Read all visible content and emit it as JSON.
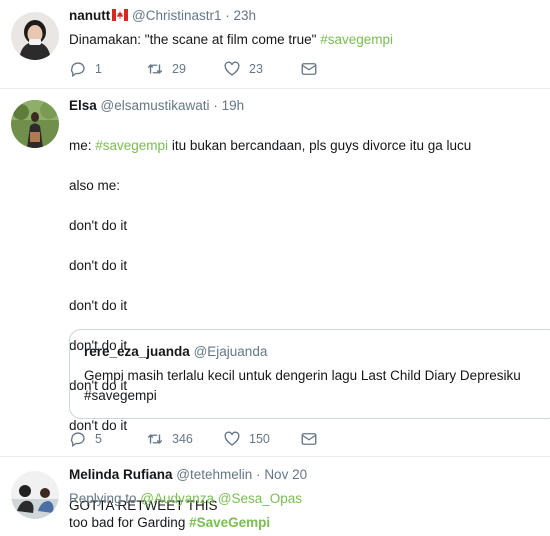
{
  "tweets": [
    {
      "name": "nanutt",
      "handle": "@Christinastr1",
      "time": "23h",
      "text_before": "Dinamakan: \"the scane at film come true\" ",
      "hashtag": "#savegempi",
      "replies": "1",
      "retweets": "29",
      "likes": "23"
    },
    {
      "name": "Elsa",
      "handle": "@elsamustikawati",
      "time": "19h",
      "line1_prefix": "me: ",
      "line1_hashtag": "#savegempi",
      "line1_suffix": " itu bukan bercandaan, pls guys divorce itu ga lucu",
      "body_lines": [
        "also me:",
        "don't do it",
        "don't do it",
        "don't do it",
        "don't do it",
        "don't do it",
        "don't do it",
        "",
        "GOTTA RETWEET THIS"
      ],
      "quote": {
        "name": "rere_eza_juanda",
        "handle": "@Ejajuanda",
        "text": "Gempi masih terlalu kecil untuk dengerin lagu Last Child Diary Depresiku",
        "hashtag": "#savegempi"
      },
      "replies": "5",
      "retweets": "346",
      "likes": "150"
    },
    {
      "name": "Melinda Rufiana",
      "handle": "@tetehmelin",
      "time": "Nov 20",
      "replying_label": "Replying to ",
      "replying_users": [
        "@Audyanza",
        "@Sesa_Opas"
      ],
      "text_before": "too bad for Garding ",
      "hashtag": "#SaveGempi"
    }
  ],
  "separator_dot": "·",
  "colors": {
    "hashtag": "#79bd53",
    "muted": "#657786",
    "border": "#e6ecf0"
  },
  "icons": [
    "reply-icon",
    "retweet-icon",
    "like-icon",
    "direct-message-icon",
    "canada-flag-icon"
  ]
}
